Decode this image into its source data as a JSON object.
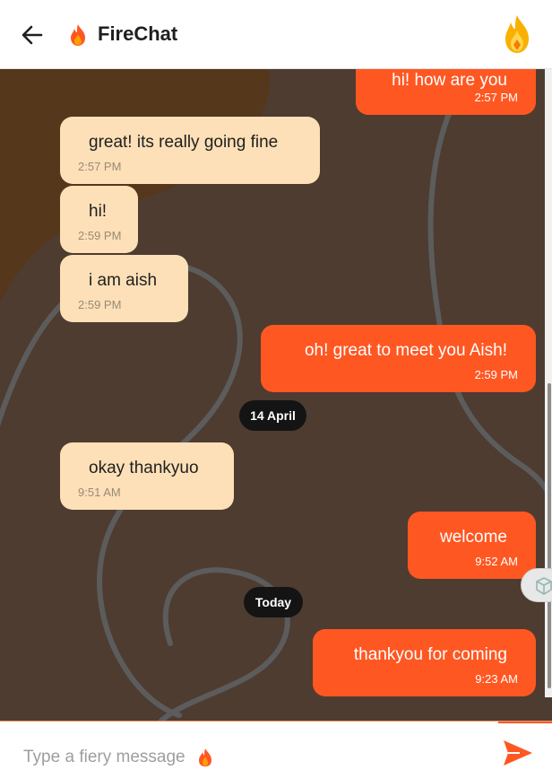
{
  "header": {
    "back_icon": "arrow-left-icon",
    "brand_icon": "flame-icon",
    "title": "FireChat",
    "logo_icon": "flame-logo-icon"
  },
  "messages": [
    {
      "direction": "outgoing",
      "text": "hi! how are you",
      "time": "2:57 PM"
    },
    {
      "direction": "incoming",
      "text": "great! its really going fine",
      "time": "2:57 PM"
    },
    {
      "direction": "incoming",
      "text": "hi!",
      "time": "2:59 PM"
    },
    {
      "direction": "incoming",
      "text": "i am aish",
      "time": "2:59 PM"
    },
    {
      "direction": "outgoing",
      "text": "oh! great to meet you Aish!",
      "time": "2:59 PM"
    },
    {
      "direction": "incoming",
      "text": "okay thankyuo",
      "time": "9:51 AM"
    },
    {
      "direction": "outgoing",
      "text": "welcome",
      "time": "9:52 AM"
    },
    {
      "direction": "outgoing",
      "text": "thankyou for coming",
      "time": "9:23 AM"
    }
  ],
  "date_separators": [
    "14 April",
    "Today"
  ],
  "composer": {
    "placeholder": "Type a fiery message",
    "value": "",
    "placeholder_icon": "flame-icon",
    "send_icon": "send-icon"
  },
  "colors": {
    "accent": "#ff5722",
    "incoming_bubble": "#fde0b7",
    "chat_background": "#4e3c31",
    "date_chip": "#141414"
  }
}
